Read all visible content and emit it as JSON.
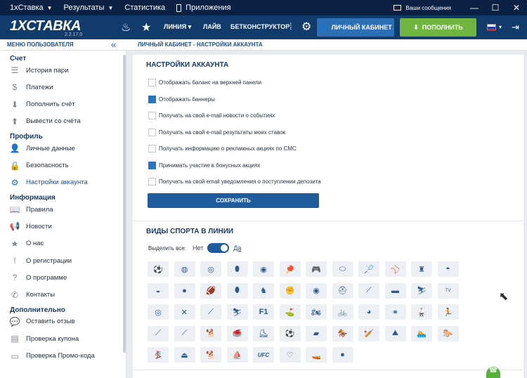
{
  "topbar": {
    "menu": [
      {
        "label": "1хСтавка",
        "has_caret": true
      },
      {
        "label": "Результаты",
        "has_caret": true
      },
      {
        "label": "Статистика",
        "has_caret": false
      },
      {
        "label": "Приложения",
        "has_caret": false
      }
    ],
    "messages_label": "Ваши сообщения",
    "window_buttons": [
      "minimize-icon",
      "maximize-icon",
      "close-icon"
    ]
  },
  "header": {
    "logo": "1ХСТАВКА",
    "version": "2.2.17.0",
    "nav": [
      "ЛИНИЯ",
      "ЛАЙВ",
      "БЕТКОНСТРУКТОР"
    ],
    "cabinet_label": "ЛИЧНЫЙ КАБИНЕТ",
    "deposit_label": "ПОПОЛНИТЬ",
    "flag_colors": [
      "#ffffff",
      "#1c3f9c",
      "#d52b1e"
    ]
  },
  "breadcrumb": {
    "sidebar_title": "МЕНЮ ПОЛЬЗОВАТЕЛЯ",
    "page_path": "ЛИЧНЫЙ КАБИНЕТ - НАСТРОЙКИ АККАУНТА"
  },
  "sidebar": {
    "sections": [
      {
        "title": "Счет",
        "items": [
          {
            "label": "История пари",
            "icon": "list-icon"
          },
          {
            "label": "Платежи",
            "icon": "dollar-icon"
          },
          {
            "label": "Пополнить счёт",
            "icon": "download-icon"
          },
          {
            "label": "Вывести со счёта",
            "icon": "upload-icon"
          }
        ]
      },
      {
        "title": "Профиль",
        "items": [
          {
            "label": "Личные данные",
            "icon": "user-icon"
          },
          {
            "label": "Безопасность",
            "icon": "lock-icon"
          },
          {
            "label": "Настройки аккаунта",
            "icon": "gear-icon",
            "active": true
          }
        ]
      },
      {
        "title": "Информация",
        "items": [
          {
            "label": "Правила",
            "icon": "book-icon"
          },
          {
            "label": "Новости",
            "icon": "megaphone-icon"
          },
          {
            "label": "О нас",
            "icon": "star-icon"
          },
          {
            "label": "О регистрации",
            "icon": "exclamation-icon"
          },
          {
            "label": "О программе",
            "icon": "question-icon"
          },
          {
            "label": "Контакты",
            "icon": "phone-icon"
          }
        ]
      },
      {
        "title": "Дополнительно",
        "items": [
          {
            "label": "Оставить отзыв",
            "icon": "chat-icon"
          },
          {
            "label": "Проверка купона",
            "icon": "coupon-icon"
          },
          {
            "label": "Проверка Промо-кода",
            "icon": "promo-icon"
          }
        ]
      }
    ]
  },
  "settings": {
    "title": "НАСТРОЙКИ АККАУНТА",
    "options": [
      {
        "label": "Отображать баланс на верхней панели",
        "checked": false
      },
      {
        "label": "Отображать баннеры",
        "checked": true
      },
      {
        "label": "Получать на свой e-mail новости о событиях",
        "checked": false
      },
      {
        "label": "Получать на свой e-mail результаты моих ставок",
        "checked": false
      },
      {
        "label": "Получать информацию о рекламных акциях по СМС",
        "checked": false
      },
      {
        "label": "Принимать участие в бонусных акциях",
        "checked": true
      },
      {
        "label": "Получать на свой email уведомления о поступлении депозита",
        "checked": false
      }
    ],
    "save_label": "СОХРАНИТЬ"
  },
  "sports": {
    "title": "ВИДЫ СПОРТА В ЛИНИИ",
    "select_all_label": "Выделить все:",
    "no_label": "Нет",
    "yes_label": "Да",
    "toggle_on": true,
    "icons": [
      "soccer-ball-icon",
      "tennis-ball-icon",
      "basketball-icon",
      "rugby-ball-icon",
      "volleyball-icon",
      "table-tennis-icon",
      "gamepad-icon",
      "ellipse-icon",
      "shuttlecock-icon",
      "baseball-icon",
      "bowling-pins-icon",
      "dome-icon",
      "cap-icon",
      "ball-icon",
      "american-football-icon",
      "rugby-icon",
      "chess-knight-icon",
      "boxing-glove-icon",
      "coin-icon",
      "helmet-icon",
      "hockey-stick-icon",
      "briefcase-icon",
      "ski-jump-icon",
      "tv-icon",
      "target-icon",
      "crossed-skis-icon",
      "cue-icon",
      "skier-icon",
      "f1-icon",
      "golf-icon",
      "motorbike-icon",
      "bicycle-icon",
      "handball-icon",
      "olympic-rings-icon",
      "martial-arts-icon",
      "runner-icon",
      "bat-icon",
      "stick-icon",
      "greyhound-icon",
      "curling-icon",
      "figure-skater-icon",
      "kick-icon",
      "tank-icon",
      "horse-racing-icon",
      "cricket-icon",
      "mountain-icon",
      "water-polo-icon",
      "racing-horse-icon",
      "snowboard-icon",
      "kettlebell-icon",
      "dog-icon",
      "sailing-icon",
      "ufc-icon",
      "heart-icon",
      "boat-icon",
      "sumo-icon"
    ],
    "f1_text": "F1",
    "ufc_text": "UFC",
    "tv_text": "TV"
  }
}
